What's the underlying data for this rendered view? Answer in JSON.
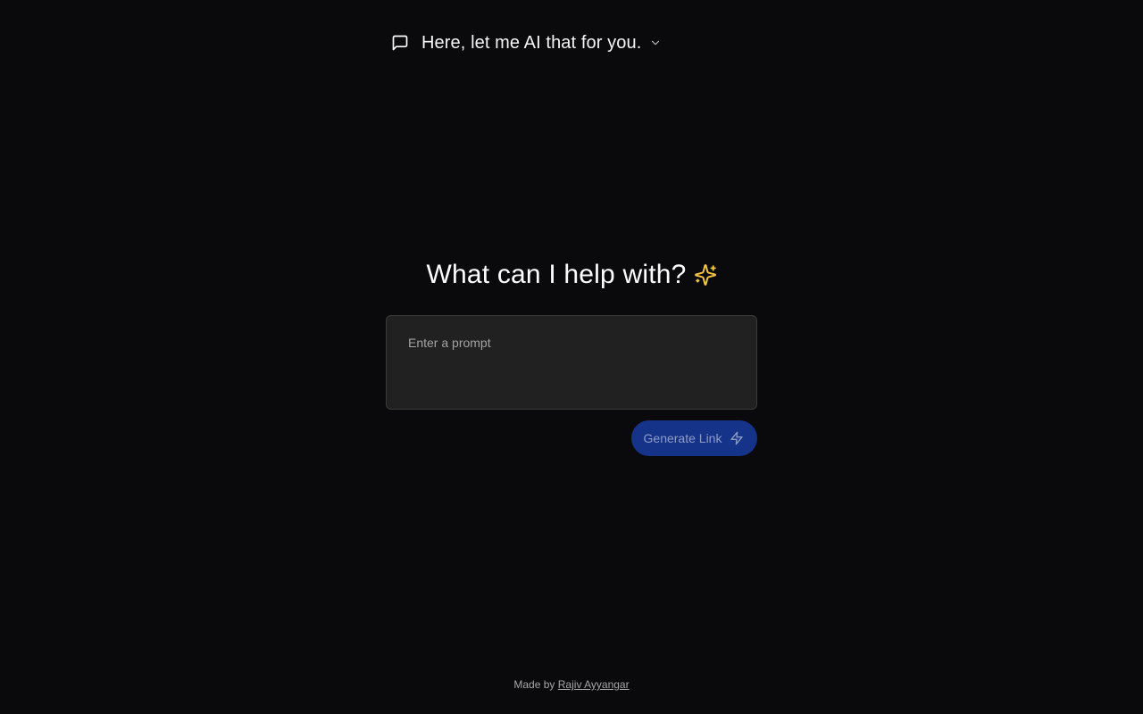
{
  "header": {
    "title": "Here, let me AI that for you.",
    "icon": "message-square-icon",
    "chevron_icon": "chevron-down-icon"
  },
  "hero": {
    "title": "What can I help with?",
    "icon": "sparkles-icon",
    "icon_color": "#f5c542"
  },
  "prompt": {
    "placeholder": "Enter a prompt",
    "value": ""
  },
  "generate_button": {
    "label": "Generate Link",
    "icon": "zap-icon",
    "background": "#16338a"
  },
  "footer": {
    "prefix": "Made by",
    "author_link": "Rajiv Ayyangar"
  }
}
